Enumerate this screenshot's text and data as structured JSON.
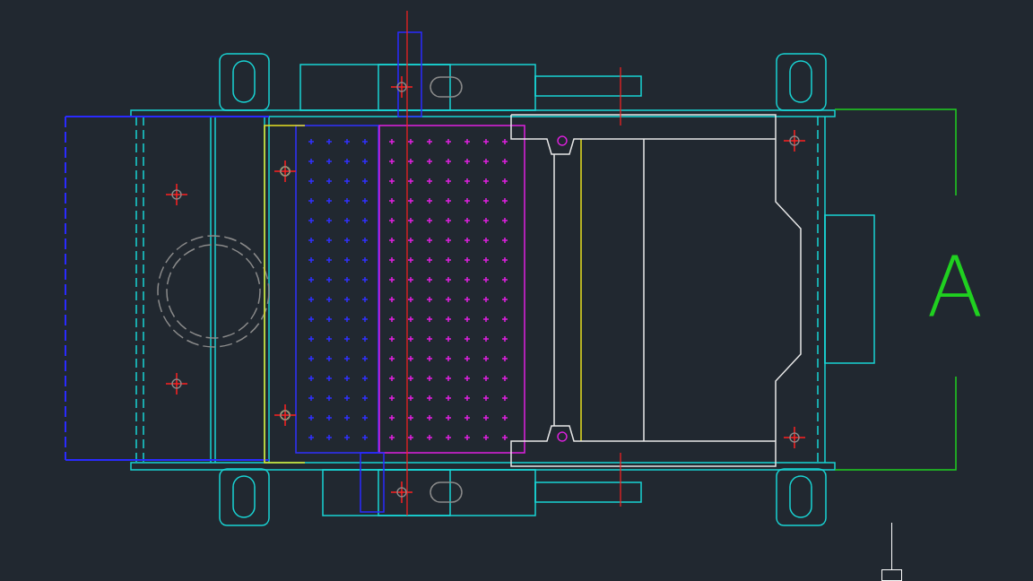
{
  "drawing": {
    "section_label": "A"
  }
}
